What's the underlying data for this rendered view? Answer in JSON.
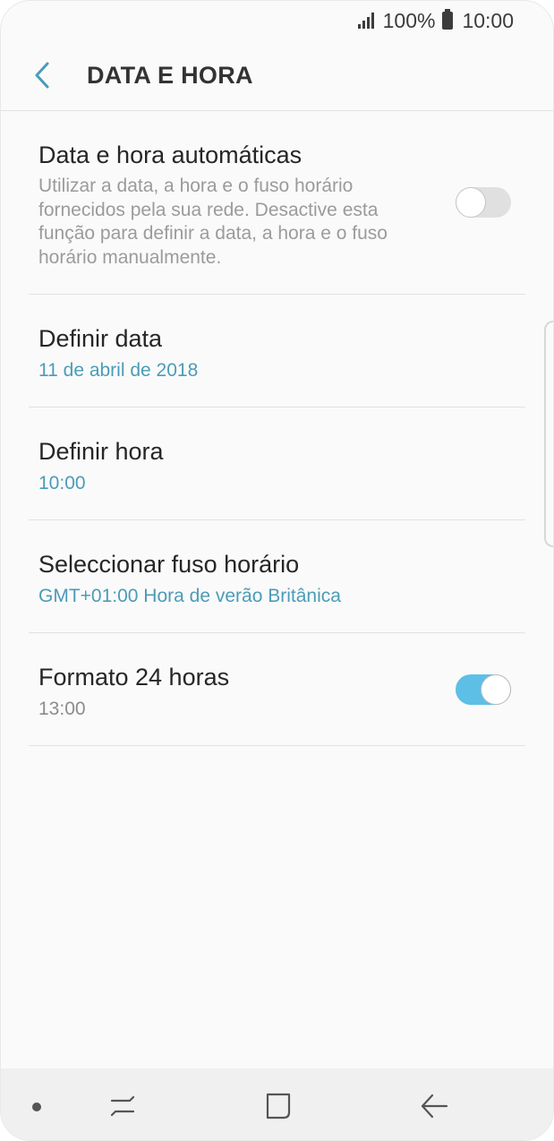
{
  "status_bar": {
    "battery_percent": "100%",
    "time": "10:00"
  },
  "header": {
    "title": "DATA E HORA"
  },
  "settings": {
    "auto": {
      "title": "Data e hora automáticas",
      "description": "Utilizar a data, a hora e o fuso horário fornecidos pela sua rede. Desactive esta função para definir a data, a hora e o fuso horário manualmente.",
      "toggle_on": false
    },
    "set_date": {
      "title": "Definir data",
      "value": "11 de abril de 2018"
    },
    "set_time": {
      "title": "Definir hora",
      "value": "10:00"
    },
    "timezone": {
      "title": "Seleccionar fuso horário",
      "value": "GMT+01:00 Hora de verão Britânica"
    },
    "format24": {
      "title": "Formato 24 horas",
      "value": "13:00",
      "toggle_on": true
    }
  },
  "colors": {
    "accent": "#4b9cb8",
    "toggle_on": "#5dbfe5",
    "toggle_off": "#e0e0e0",
    "background": "#fafafa"
  },
  "icons": {
    "back": "chevron-left-icon",
    "recents": "recents-icon",
    "home": "home-icon",
    "nav_back": "back-arrow-icon"
  }
}
